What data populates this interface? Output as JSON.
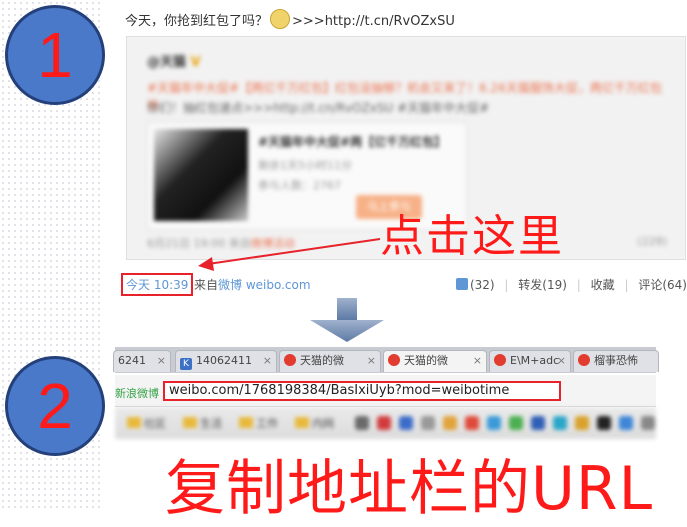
{
  "steps": {
    "one": "1",
    "two": "2"
  },
  "post": {
    "text": "今天，你抢到红包了吗？",
    "link": ">>>http://t.cn/RvOZxSU",
    "quoted": {
      "author": "@天猫",
      "verified": "V",
      "line1": "#天猫年中大促#【两亿千万红包】红包没抽够？机会又来了！6.26天猫服饰大促，两亿千万红包给",
      "line2": "你们！抽红包速点>>>http://t.cn/RvOZxSU    #天猫年中大促#",
      "card_title": "#天猫年中大促#两【亿千万红包】",
      "card_line1": "剩余1天5小时11分",
      "card_line2": "参与人数：2767",
      "card_button": "马上参与",
      "date": "6月21日 19:00",
      "from": "来自",
      "from_app": "微博活动",
      "counts": "(228)"
    },
    "time": "今天 10:39",
    "source_prefix": "来自",
    "source_link": "微博 weibo.com",
    "actions": {
      "like": "(32)",
      "repost": "转发(19)",
      "fav": "收藏",
      "comment": "评论(64)"
    }
  },
  "callouts": {
    "click_here": "点击这里",
    "copy_url": "复制地址栏的URL"
  },
  "browser": {
    "tabs": [
      {
        "label": "6241",
        "color": "#f0f0f0"
      },
      {
        "label": "14062411",
        "color": "#3c71c5"
      },
      {
        "label": "天猫的微",
        "color": "#e23b2f"
      },
      {
        "label": "天猫的微",
        "color": "#e23b2f"
      },
      {
        "label": "E\\M+adc",
        "color": "#e23b2f"
      },
      {
        "label": "榴亊恐怖",
        "color": "#e23b2f"
      }
    ],
    "address_prefix": "新浪微博",
    "url": "weibo.com/1768198384/BasIxiUyb?mod=weibotime",
    "bookmarks": [
      "社区",
      "生活",
      "工作",
      "内网"
    ]
  }
}
